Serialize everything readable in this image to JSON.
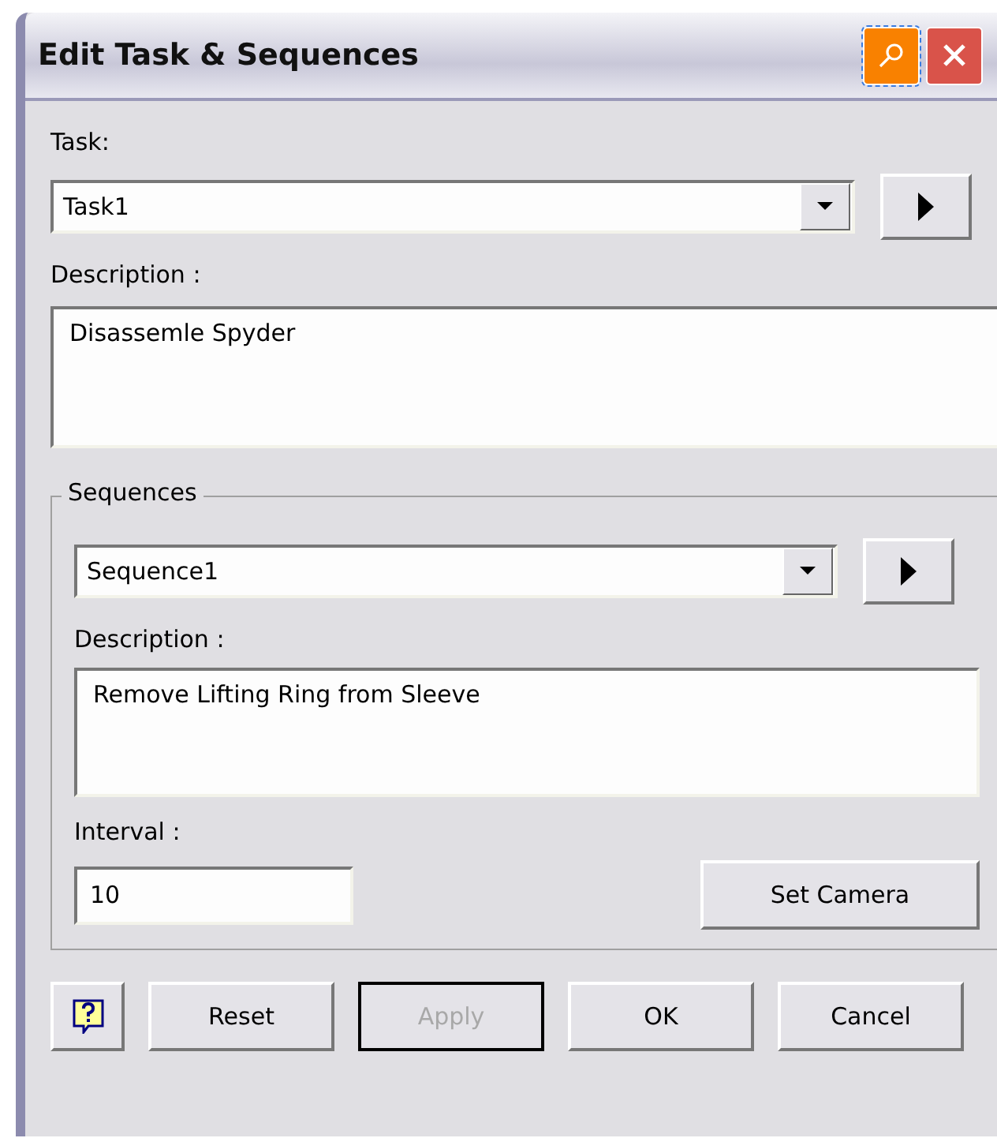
{
  "window": {
    "title": "Edit Task & Sequences",
    "controls": [
      {
        "kind": "pin"
      },
      {
        "kind": "close"
      }
    ]
  },
  "task": {
    "label": "Task:",
    "value": "Task1",
    "description_label": "Description :",
    "description": "Disassemle Spyder"
  },
  "sequences": {
    "title": "Sequences",
    "value": "Sequence1",
    "description_label": "Description :",
    "description": "Remove Lifting Ring from Sleeve",
    "interval_label": "Interval :",
    "interval": "10",
    "camera_button": "Set Camera"
  },
  "buttons": [
    {
      "kind": "help"
    },
    {
      "kind": "text",
      "label": "Reset",
      "disabled": false,
      "default": false
    },
    {
      "kind": "text",
      "label": "Apply",
      "disabled": true,
      "default": true
    },
    {
      "kind": "text",
      "label": "OK",
      "disabled": false,
      "default": false
    },
    {
      "kind": "text",
      "label": "Cancel",
      "disabled": false,
      "default": false
    }
  ]
}
